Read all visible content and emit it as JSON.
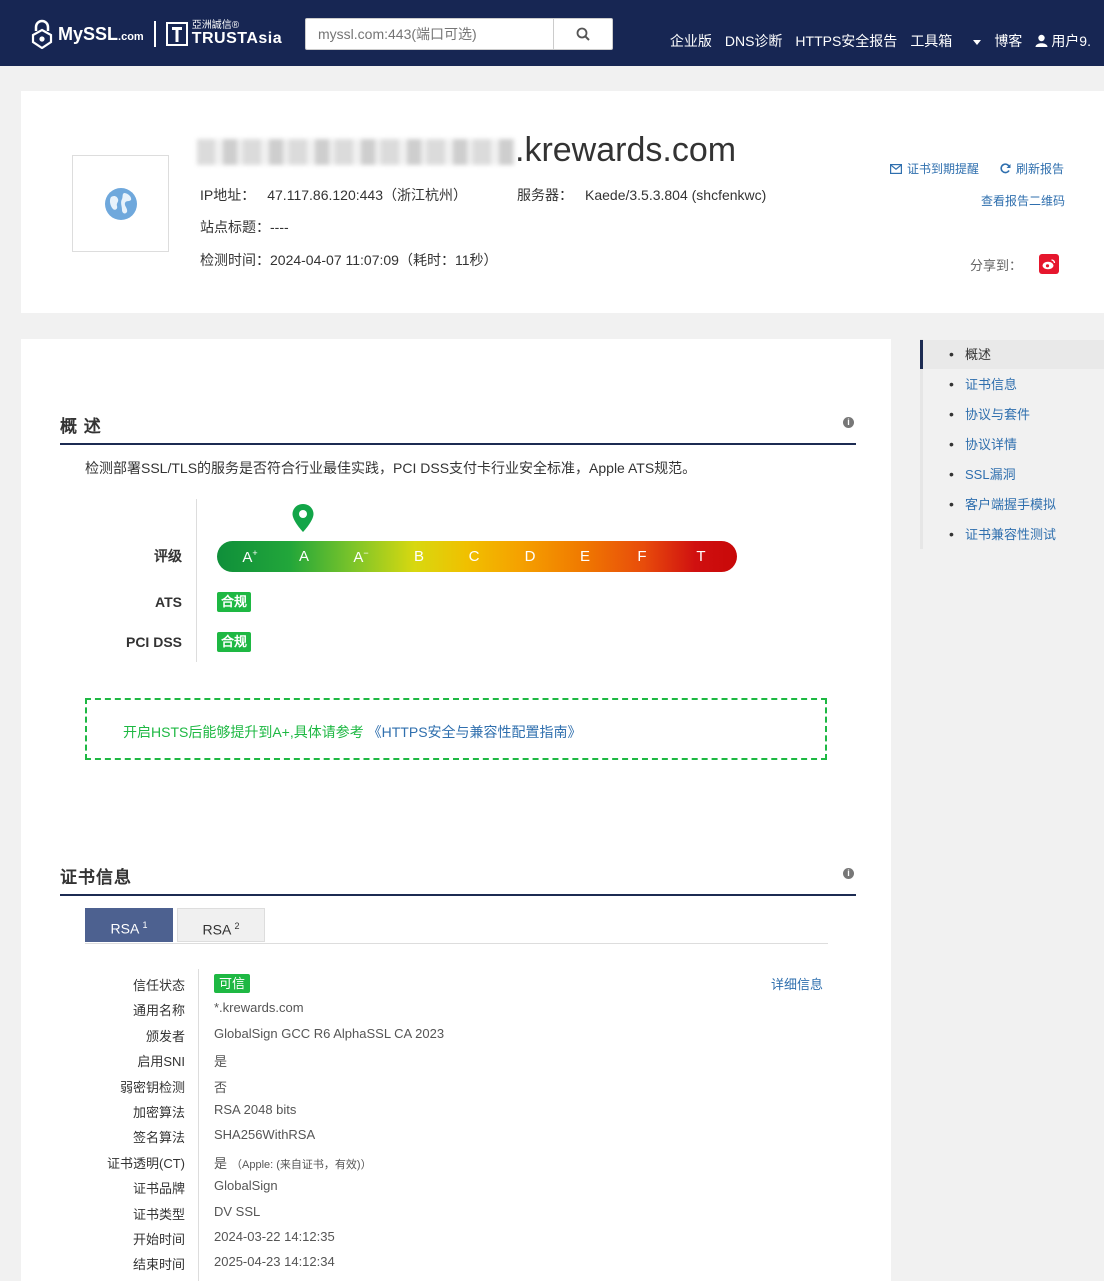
{
  "header": {
    "logo_text": "MySSL",
    "logo_suffix": ".com",
    "brand_cn": "亞洲誠信®",
    "brand_en": "TRUSTAsia",
    "search_placeholder": "myssl.com:443(端口可选)",
    "nav": [
      "企业版",
      "DNS诊断",
      "HTTPS安全报告",
      "工具箱",
      "博客",
      "用户9."
    ]
  },
  "report": {
    "domain_suffix": ".krewards.com",
    "ip_label": "IP地址：",
    "ip_value": "47.117.86.120:443（浙江杭州）",
    "server_label": "服务器：",
    "server_value": "Kaede/3.5.3.804 (shcfenkwc)",
    "title_label": "站点标题：",
    "title_value": "----",
    "time_label": "检测时间：",
    "time_value": "2024-04-07 11:07:09（耗时：11秒）",
    "link_expiry": "证书到期提醒",
    "link_refresh": "刷新报告",
    "link_qr": "查看报告二维码",
    "share_label": "分享到："
  },
  "overview": {
    "heading": "概 述",
    "info_icon": "i",
    "description": "检测部署SSL/TLS的服务是否符合行业最佳实践，PCI DSS支付卡行业安全标准，Apple ATS规范。",
    "rating_label": "评级",
    "grades": [
      "A",
      "A",
      "A",
      "B",
      "C",
      "D",
      "E",
      "F",
      "T"
    ],
    "grade_marks": [
      "+",
      "",
      "−",
      "",
      "",
      "",
      "",
      "",
      ""
    ],
    "current_grade": "A",
    "ats_label": "ATS",
    "ats_status": "合规",
    "pci_label": "PCI DSS",
    "pci_status": "合规",
    "hsts_tip": "开启HSTS后能够提升到A+,具体请参考",
    "hsts_link": "《HTTPS安全与兼容性配置指南》"
  },
  "cert": {
    "heading": "证书信息",
    "info_icon": "i",
    "tabs": [
      {
        "label": "RSA",
        "sup": "1"
      },
      {
        "label": "RSA",
        "sup": "2"
      }
    ],
    "detail_link": "详细信息",
    "rows": [
      {
        "k": "信任状态",
        "v": "可信"
      },
      {
        "k": "通用名称",
        "v": "*.krewards.com"
      },
      {
        "k": "颁发者",
        "v": "GlobalSign GCC R6 AlphaSSL CA 2023"
      },
      {
        "k": "启用SNI",
        "v": "是"
      },
      {
        "k": "弱密钥检测",
        "v": "否"
      },
      {
        "k": "加密算法",
        "v": "RSA 2048 bits"
      },
      {
        "k": "签名算法",
        "v": "SHA256WithRSA"
      },
      {
        "k": "证书透明(CT)",
        "v": "是",
        "note": "（Apple: (来自证书，有效)）"
      },
      {
        "k": "证书品牌",
        "v": "GlobalSign"
      },
      {
        "k": "证书类型",
        "v": "DV SSL"
      },
      {
        "k": "开始时间",
        "v": "2024-03-22 14:12:35"
      },
      {
        "k": "结束时间",
        "v": "2025-04-23 14:12:34"
      }
    ]
  },
  "sidebar": {
    "items": [
      "概述",
      "证书信息",
      "协议与套件",
      "协议详情",
      "SSL漏洞",
      "客户端握手模拟",
      "证书兼容性测试"
    ]
  },
  "colors": {
    "navy": "#172653",
    "green": "#1eb843",
    "link": "#2f6fae"
  }
}
